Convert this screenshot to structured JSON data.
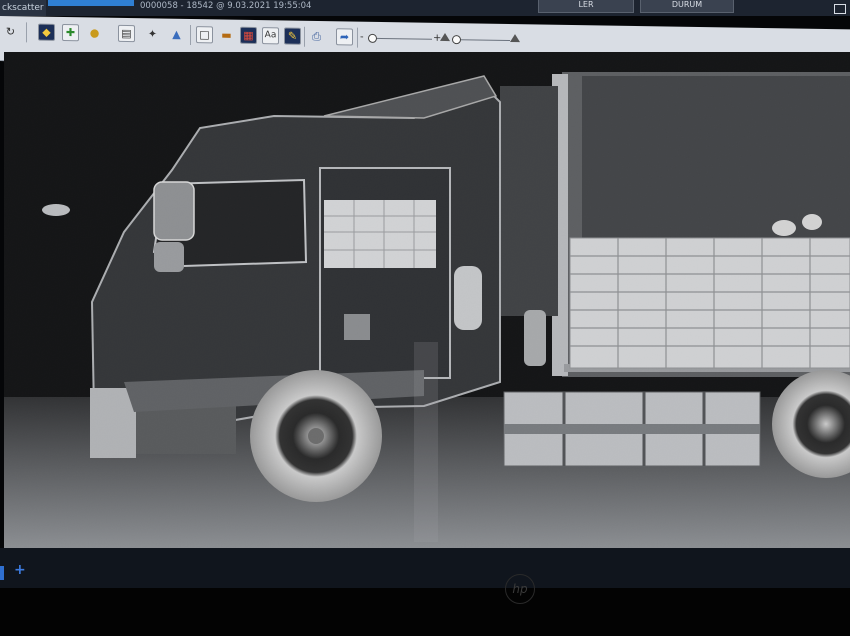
{
  "app": {
    "tab_label": "ckscatter"
  },
  "header": {
    "scan_info": "0000058 - 18542 @ 9.03.2021 19:55:04",
    "reports_button": "LER",
    "status_button": "DURUM"
  },
  "toolbar": {
    "icons": [
      "refresh-icon",
      "map-pin-icon",
      "puzzle-icon",
      "palette-icon",
      "document-icon",
      "magic-wand-icon",
      "drop-icon",
      "frame-icon",
      "ruler-icon",
      "film-icon",
      "text-icon",
      "pen-icon",
      "printer-icon",
      "export-icon"
    ],
    "text_button_label": "Aa",
    "slider_minus": "-",
    "slider_plus": "+"
  },
  "viewer": {
    "content": "backscatter-xray-scan-of-truck"
  },
  "colors": {
    "accent": "#2f7fd3",
    "toolbar": "#d9dde4",
    "background": "#050608"
  }
}
